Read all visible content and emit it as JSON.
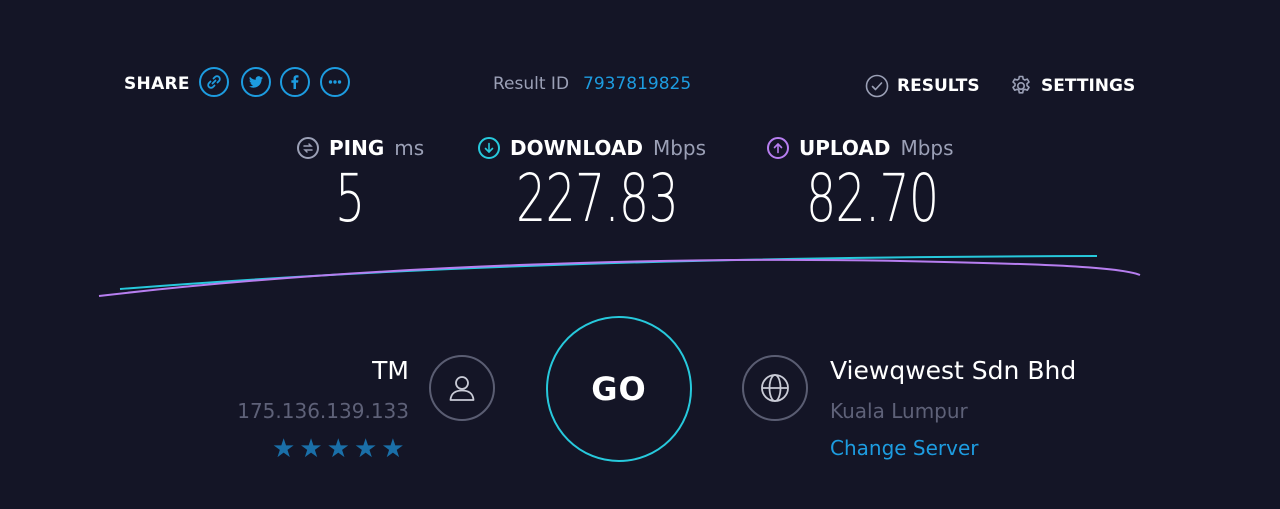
{
  "header": {
    "share_label": "SHARE",
    "share_buttons": [
      "link-icon",
      "twitter-icon",
      "facebook-icon",
      "more-icon"
    ],
    "result_label": "Result ID",
    "result_id": "7937819825",
    "results_label": "RESULTS",
    "settings_label": "SETTINGS"
  },
  "metrics": {
    "ping": {
      "label": "PING",
      "unit": "ms",
      "value": "5",
      "icon": "ping-icon",
      "color": "#9ba0b6"
    },
    "download": {
      "label": "DOWNLOAD",
      "unit": "Mbps",
      "value": "227.83",
      "icon": "download-arrow-icon",
      "color": "#27c9dc"
    },
    "upload": {
      "label": "UPLOAD",
      "unit": "Mbps",
      "value": "82.70",
      "icon": "upload-arrow-icon",
      "color": "#b77ef0"
    }
  },
  "isp": {
    "name": "TM",
    "ip": "175.136.139.133",
    "rating": 5,
    "icon": "user-icon"
  },
  "go_button": {
    "label": "GO"
  },
  "server": {
    "name": "Viewqwest Sdn Bhd",
    "location": "Kuala Lumpur",
    "change_label": "Change Server",
    "icon": "globe-icon"
  },
  "colors": {
    "background": "#141526",
    "accent_blue": "#1d9ce0",
    "download_cyan": "#27c9dc",
    "upload_purple": "#b77ef0",
    "star": "#1a6fa8"
  }
}
